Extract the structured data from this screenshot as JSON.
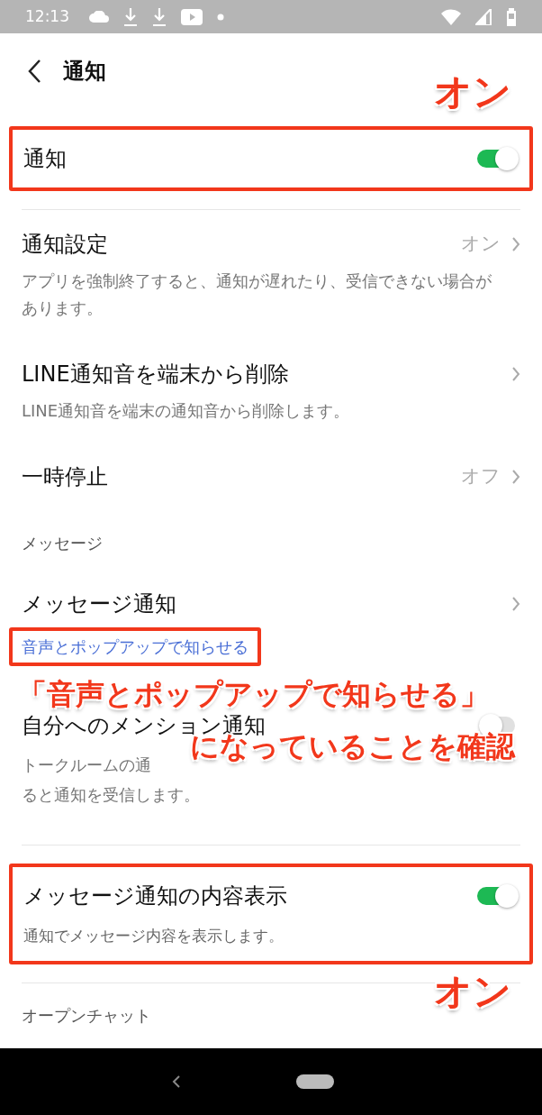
{
  "status_bar": {
    "time": "12:13"
  },
  "header": {
    "title": "通知"
  },
  "rows": [
    {
      "kind": "toggle",
      "title": "通知",
      "on": true,
      "highlighted": true
    },
    {
      "kind": "divider"
    },
    {
      "kind": "link",
      "title": "通知設定",
      "value": "オン",
      "description": "アプリを強制終了すると、通知が遅れたり、受信できない場合があります。"
    },
    {
      "kind": "link",
      "title": "LINE通知音を端末から削除",
      "description": "LINE通知音を端末の通知音から削除します。"
    },
    {
      "kind": "link",
      "title": "一時停止",
      "value": "オフ"
    },
    {
      "kind": "section",
      "title": "メッセージ"
    },
    {
      "kind": "link",
      "title": "メッセージ通知",
      "status": "音声とポップアップで知らせる",
      "status_highlighted": true
    },
    {
      "kind": "toggle",
      "title": "自分へのメンション通知",
      "on": false,
      "description_lines": [
        "トークルームの通",
        "ると通知を受信します。"
      ]
    },
    {
      "kind": "divider"
    },
    {
      "kind": "toggle",
      "title": "メッセージ通知の内容表示",
      "on": true,
      "description": "通知でメッセージ内容を表示します。",
      "highlighted": true
    },
    {
      "kind": "divider"
    },
    {
      "kind": "section",
      "title": "オープンチャット"
    }
  ],
  "annotations": {
    "on_labels": [
      "オン",
      "オン"
    ],
    "callout": [
      "「音声とポップアップで知らせる」",
      "になっていることを確認"
    ]
  }
}
